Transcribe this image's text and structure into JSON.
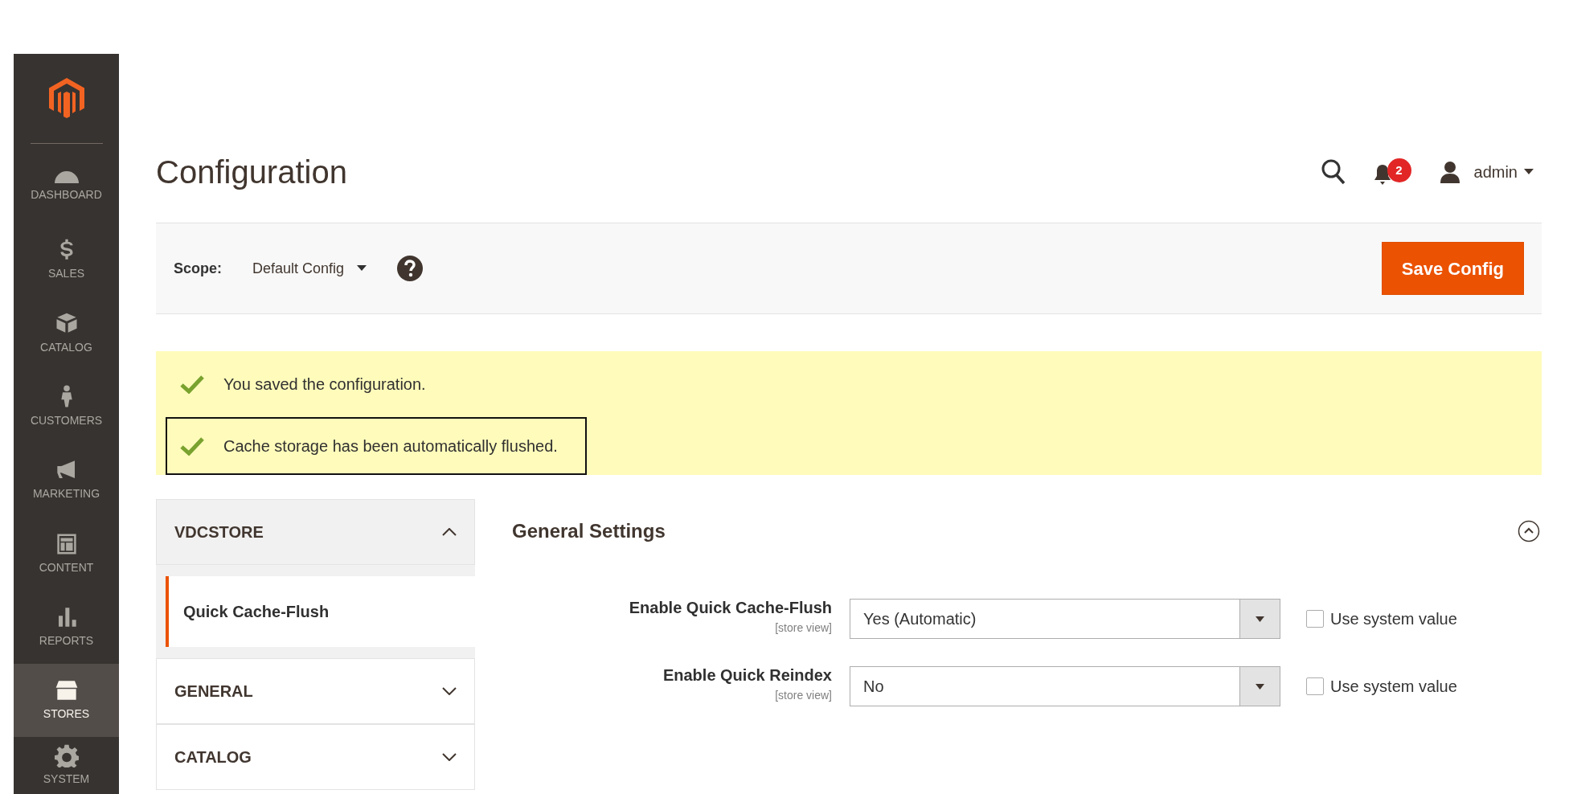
{
  "sidebar": {
    "items": [
      {
        "label": "DASHBOARD",
        "selected": false
      },
      {
        "label": "SALES",
        "selected": false
      },
      {
        "label": "CATALOG",
        "selected": false
      },
      {
        "label": "CUSTOMERS",
        "selected": false
      },
      {
        "label": "MARKETING",
        "selected": false
      },
      {
        "label": "CONTENT",
        "selected": false
      },
      {
        "label": "REPORTS",
        "selected": false
      },
      {
        "label": "STORES",
        "selected": true
      },
      {
        "label": "SYSTEM",
        "selected": false
      }
    ]
  },
  "header": {
    "title": "Configuration",
    "notification_count": "2",
    "user": "admin"
  },
  "scope_bar": {
    "label": "Scope:",
    "value": "Default Config",
    "button": "Save Config"
  },
  "messages": [
    {
      "text": "You saved the configuration.",
      "outlined": false
    },
    {
      "text": "Cache storage has been automatically flushed.",
      "outlined": true
    }
  ],
  "config_tabs": [
    {
      "title": "VDCSTORE",
      "expanded": true,
      "children": [
        {
          "label": "Quick Cache-Flush",
          "selected": true
        }
      ]
    },
    {
      "title": "GENERAL",
      "expanded": false
    },
    {
      "title": "CATALOG",
      "expanded": false
    }
  ],
  "section": {
    "title": "General Settings",
    "expanded": true,
    "fields": [
      {
        "label": "Enable Quick Cache-Flush",
        "scope": "[store view]",
        "value": "Yes (Automatic)",
        "checkbox_label": "Use system value",
        "checked": false
      },
      {
        "label": "Enable Quick Reindex",
        "scope": "[store view]",
        "value": "No",
        "checkbox_label": "Use system value",
        "checked": false
      }
    ]
  }
}
